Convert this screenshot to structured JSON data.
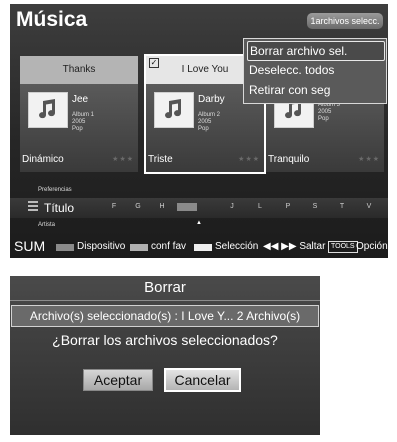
{
  "screen1": {
    "title": "Música",
    "selection_badge": "1archivos selecc.",
    "cards": [
      {
        "song": "Thanks",
        "artist": "Jee",
        "album": "Album 1",
        "year": "2005",
        "genre": "Pop",
        "mood": "Dinámico",
        "rating": "★★★",
        "checked": false
      },
      {
        "song": "I Love You",
        "artist": "Darby",
        "album": "Album 2",
        "year": "2005",
        "genre": "Pop",
        "mood": "Triste",
        "rating": "★★★",
        "checked": true
      },
      {
        "song": "",
        "artist": "",
        "album": "Album 3",
        "year": "2005",
        "genre": "Pop",
        "mood": "Tranquilo",
        "rating": "★★★",
        "checked": false
      }
    ],
    "context_menu": {
      "items": [
        "Borrar archivo sel.",
        "Deselecc. todos",
        "Retirar con seg"
      ],
      "highlighted": "Borrar archivo sel."
    },
    "sort": {
      "previous": "Preferencias",
      "current": "Título",
      "next": "Artista",
      "letters": [
        "F",
        "G",
        "H",
        "",
        "J",
        "L",
        "P",
        "S",
        "T",
        "V"
      ]
    },
    "help": {
      "sum": "SUM",
      "device": "Dispositivo",
      "conf_fav": "conf fav",
      "selection": "Selección",
      "jump": "◀◀ ▶▶ Saltar",
      "tools": "TOOLS",
      "option": "Opción"
    }
  },
  "dialog": {
    "title": "Borrar",
    "info": "Archivo(s) seleccionado(s) : I Love Y... 2 Archivo(s)",
    "question": "¿Borrar los archivos seleccionados?",
    "ok_label": "Aceptar",
    "cancel_label": "Cancelar",
    "focused": "Cancelar"
  },
  "colors": {
    "card_head": "#b4b4b4",
    "card_head_selected": "#e6e6e6",
    "swatch_device": "#8a8a8a",
    "swatch_fav": "#b0b0b0",
    "swatch_selection": "#eeeeee"
  }
}
